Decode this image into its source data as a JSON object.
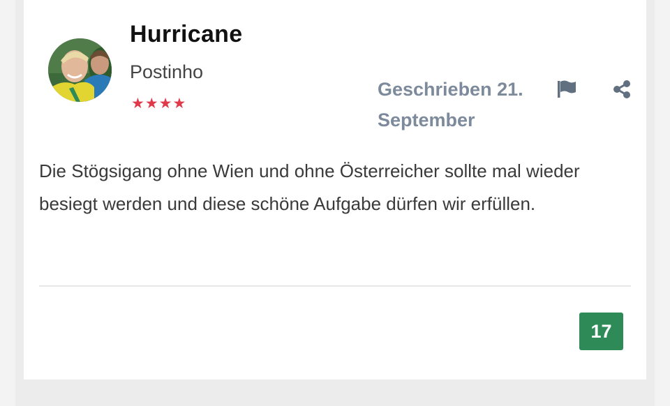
{
  "post": {
    "author": {
      "name": "Hurricane",
      "rank_title": "Postinho",
      "rank_stars": 4
    },
    "posted_date": "Geschrieben 21. September",
    "body": "Die Stögsigang ohne Wien und ohne Österreicher sollte mal wieder besiegt werden und diese schöne Aufgabe dürfen wir erfüllen.",
    "reaction_count": "17"
  },
  "icons": {
    "report": "flag-icon",
    "share": "share-icon",
    "rank": "star-icon"
  },
  "colors": {
    "star": "#e03a4a",
    "date": "#7c8a9b",
    "reaction_badge": "#2e8b57",
    "background": "#ececec",
    "card": "#ffffff"
  }
}
